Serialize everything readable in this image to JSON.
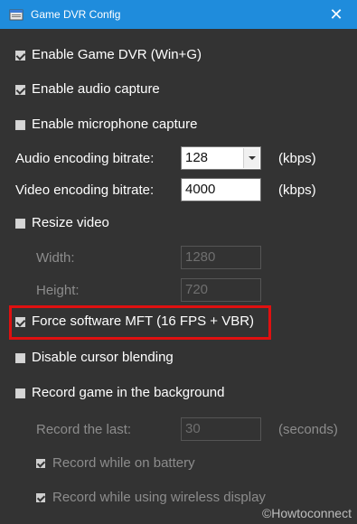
{
  "window": {
    "title": "Game DVR Config",
    "close_symbol": "✕"
  },
  "options": {
    "enable_game_dvr": {
      "label": "Enable Game DVR (Win+G)",
      "checked": true
    },
    "enable_audio_capture": {
      "label": "Enable audio capture",
      "checked": true
    },
    "enable_mic_capture": {
      "label": "Enable microphone capture",
      "checked": false
    },
    "audio_bitrate": {
      "label": "Audio encoding bitrate:",
      "value": "128",
      "unit": "(kbps)"
    },
    "video_bitrate": {
      "label": "Video encoding bitrate:",
      "value": "4000",
      "unit": "(kbps)"
    },
    "resize_video": {
      "label": "Resize video",
      "checked": false
    },
    "width": {
      "label": "Width:",
      "value": "1280"
    },
    "height": {
      "label": "Height:",
      "value": "720"
    },
    "force_software_mft": {
      "label": "Force software MFT (16 FPS + VBR)",
      "checked": true
    },
    "disable_cursor_blending": {
      "label": "Disable cursor blending",
      "checked": false
    },
    "record_background": {
      "label": "Record game in the background",
      "checked": false
    },
    "record_last": {
      "label": "Record the last:",
      "value": "30",
      "unit": "(seconds)"
    },
    "record_on_battery": {
      "label": "Record while on battery",
      "checked": true
    },
    "record_wireless": {
      "label": "Record while using wireless display",
      "checked": true
    }
  },
  "watermark": "©Howtoconnect",
  "colors": {
    "titlebar": "#1f8cdc",
    "background": "#333333",
    "highlight": "#e01010"
  }
}
